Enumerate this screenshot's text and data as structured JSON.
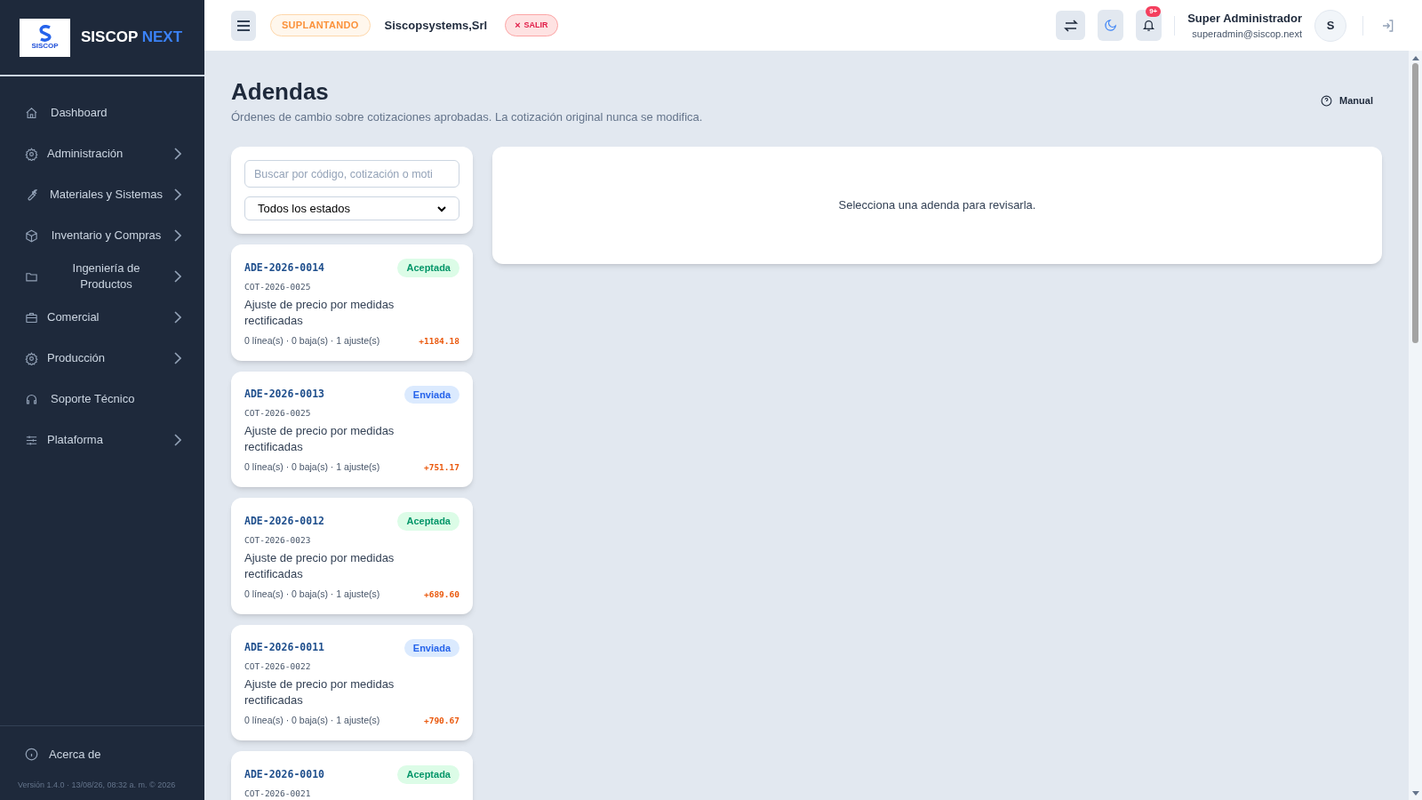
{
  "brand": {
    "name": "SISCOP",
    "suffix": "NEXT",
    "logo_text": "SISCOP"
  },
  "sidebar": {
    "items": [
      {
        "label": "Dashboard",
        "expandable": false
      },
      {
        "label": "Administración",
        "expandable": true
      },
      {
        "label": "Materiales y Sistemas",
        "expandable": true
      },
      {
        "label": "Inventario y Compras",
        "expandable": true
      },
      {
        "label": "Ingeniería de Productos",
        "expandable": true
      },
      {
        "label": "Comercial",
        "expandable": true
      },
      {
        "label": "Producción",
        "expandable": true
      },
      {
        "label": "Soporte Técnico",
        "expandable": false
      },
      {
        "label": "Plataforma",
        "expandable": true
      }
    ],
    "footer_item": "Acerca de",
    "version": "Versión 1.4.0 · 13/08/26, 08:32 a. m. © 2026"
  },
  "header": {
    "impersonating_badge": "SUPLANTANDO",
    "company": "Siscopsystems,Srl",
    "exit_button": "SALIR",
    "exit_icon": "×",
    "notification_count": "9+",
    "user_name": "Super Administrador",
    "user_email": "superadmin@siscop.next",
    "avatar": "S"
  },
  "page": {
    "title": "Adendas",
    "subtitle": "Órdenes de cambio sobre cotizaciones aprobadas. La cotización original nunca se modifica.",
    "manual_link": "Manual"
  },
  "filters": {
    "search_placeholder": "Buscar por código, cotización o moti",
    "status_select": "Todos los estados"
  },
  "addenda": [
    {
      "code": "ADE-2026-0014",
      "quote": "COT-2026-0025",
      "status": "Aceptada",
      "kind": "accepted",
      "description": "Ajuste de precio por medidas rectificadas",
      "summary": "0 línea(s) · 0 baja(s) · 1 ajuste(s)",
      "amount": "+1184.18"
    },
    {
      "code": "ADE-2026-0013",
      "quote": "COT-2026-0025",
      "status": "Enviada",
      "kind": "sent",
      "description": "Ajuste de precio por medidas rectificadas",
      "summary": "0 línea(s) · 0 baja(s) · 1 ajuste(s)",
      "amount": "+751.17"
    },
    {
      "code": "ADE-2026-0012",
      "quote": "COT-2026-0023",
      "status": "Aceptada",
      "kind": "accepted",
      "description": "Ajuste de precio por medidas rectificadas",
      "summary": "0 línea(s) · 0 baja(s) · 1 ajuste(s)",
      "amount": "+689.60"
    },
    {
      "code": "ADE-2026-0011",
      "quote": "COT-2026-0022",
      "status": "Enviada",
      "kind": "sent",
      "description": "Ajuste de precio por medidas rectificadas",
      "summary": "0 línea(s) · 0 baja(s) · 1 ajuste(s)",
      "amount": "+790.67"
    },
    {
      "code": "ADE-2026-0010",
      "quote": "COT-2026-0021",
      "status": "Aceptada",
      "kind": "accepted"
    }
  ],
  "detail": {
    "empty_message": "Selecciona una adenda para revisarla."
  }
}
